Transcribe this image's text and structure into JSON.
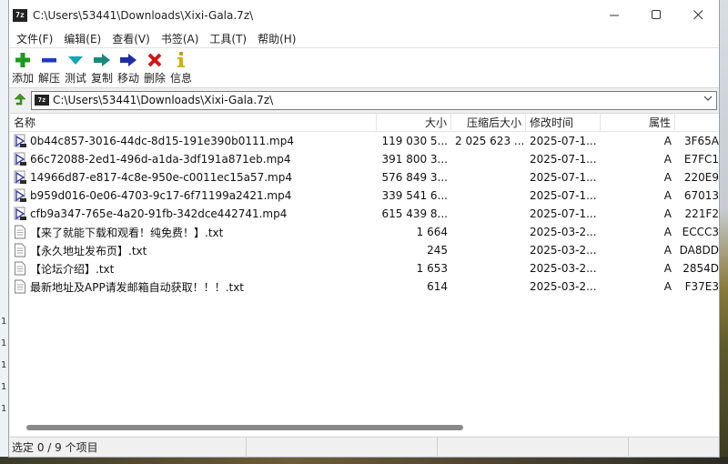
{
  "window": {
    "title": "C:\\Users\\53441\\Downloads\\Xixi-Gala.7z\\",
    "app_icon_text": "7z"
  },
  "menu": [
    "文件(F)",
    "编辑(E)",
    "查看(V)",
    "书签(A)",
    "工具(T)",
    "帮助(H)"
  ],
  "toolbar": [
    {
      "label": "添加",
      "icon": "add-icon",
      "color": "#1a9b1a"
    },
    {
      "label": "解压",
      "icon": "extract-icon",
      "color": "#1d39c4"
    },
    {
      "label": "测试",
      "icon": "test-icon",
      "color": "#12a5b8"
    },
    {
      "label": "复制",
      "icon": "copy-icon",
      "color": "#1b8a7a"
    },
    {
      "label": "移动",
      "icon": "move-icon",
      "color": "#1d2fa8"
    },
    {
      "label": "删除",
      "icon": "delete-icon",
      "color": "#d41515"
    },
    {
      "label": "信息",
      "icon": "info-icon",
      "color": "#d4b200"
    }
  ],
  "address": {
    "path": "C:\\Users\\53441\\Downloads\\Xixi-Gala.7z\\"
  },
  "columns": {
    "name": "名称",
    "size": "大小",
    "packed": "压缩后大小",
    "mtime": "修改时间",
    "attr": "属性"
  },
  "files": [
    {
      "name": "0b44c857-3016-44dc-8d15-191e390b0111.mp4",
      "type": "video",
      "size": "119 030 5...",
      "packed": "2 025 623 ...",
      "mtime": "2025-07-1...",
      "attr": "A",
      "crc": "3F65A"
    },
    {
      "name": "66c72088-2ed1-496d-a1da-3df191a871eb.mp4",
      "type": "video",
      "size": "391 800 3...",
      "packed": "",
      "mtime": "2025-07-1...",
      "attr": "A",
      "crc": "E7FC1"
    },
    {
      "name": "14966d87-e817-4c8e-950e-c0011ec15a57.mp4",
      "type": "video",
      "size": "576 849 3...",
      "packed": "",
      "mtime": "2025-07-1...",
      "attr": "A",
      "crc": "220E9"
    },
    {
      "name": "b959d016-0e06-4703-9c17-6f71199a2421.mp4",
      "type": "video",
      "size": "339 541 6...",
      "packed": "",
      "mtime": "2025-07-1...",
      "attr": "A",
      "crc": "67013"
    },
    {
      "name": "cfb9a347-765e-4a20-91fb-342dce442741.mp4",
      "type": "video",
      "size": "615 439 8...",
      "packed": "",
      "mtime": "2025-07-1...",
      "attr": "A",
      "crc": "221F2"
    },
    {
      "name": "【来了就能下载和观看！纯免费！】.txt",
      "type": "text",
      "size": "1 664",
      "packed": "",
      "mtime": "2025-03-2...",
      "attr": "A",
      "crc": "ECCC3"
    },
    {
      "name": "【永久地址发布页】.txt",
      "type": "text",
      "size": "245",
      "packed": "",
      "mtime": "2025-03-2...",
      "attr": "A",
      "crc": "DA8DD"
    },
    {
      "name": "【论坛介绍】.txt",
      "type": "text",
      "size": "1 653",
      "packed": "",
      "mtime": "2025-03-2...",
      "attr": "A",
      "crc": "2854D"
    },
    {
      "name": "最新地址及APP请发邮箱自动获取！！！.txt",
      "type": "text",
      "size": "614",
      "packed": "",
      "mtime": "2025-03-2...",
      "attr": "A",
      "crc": "F37E3"
    }
  ],
  "status": {
    "selection": "选定 0 / 9 个项目"
  }
}
